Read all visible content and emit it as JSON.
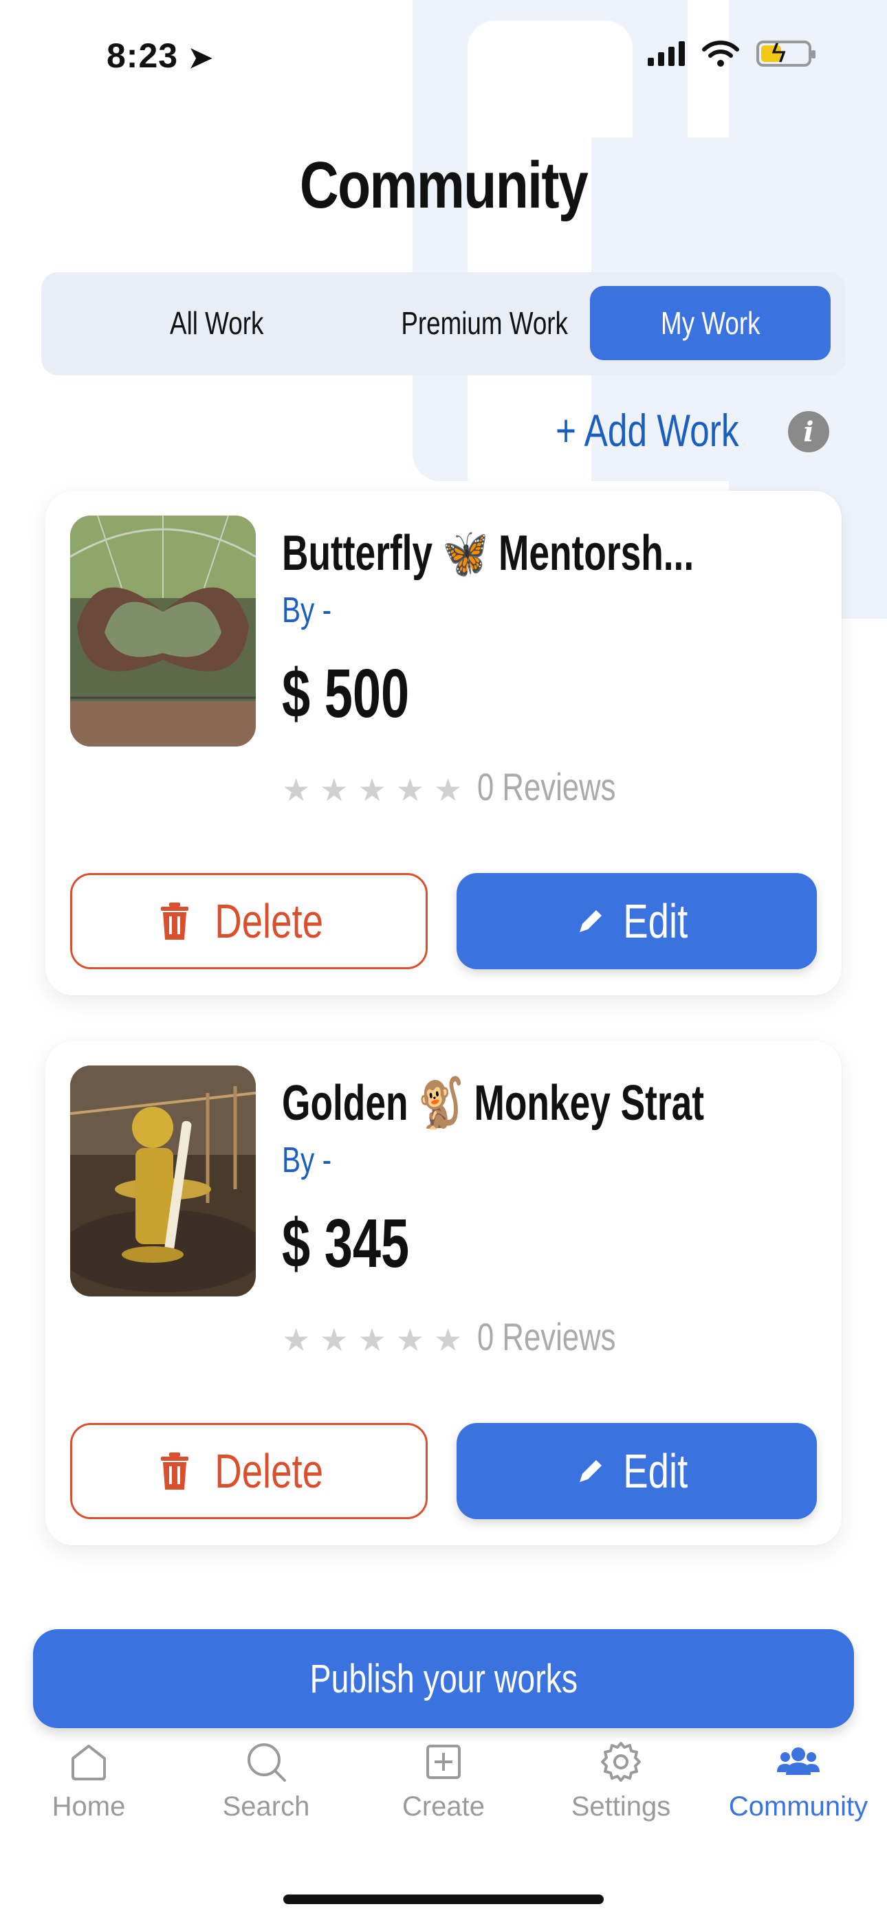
{
  "status": {
    "time": "8:23"
  },
  "page": {
    "title": "Community"
  },
  "tabs": [
    {
      "label": "All Work",
      "active": false
    },
    {
      "label": "Premium Work",
      "active": false
    },
    {
      "label": "My Work",
      "active": true
    }
  ],
  "add_work": {
    "label": "+ Add Work"
  },
  "cards": [
    {
      "title": " Butterfly 🦋 Mentorsh...",
      "by": "By -",
      "price": "$ 500",
      "rating": 0,
      "reviews": "0 Reviews",
      "delete_label": "Delete",
      "edit_label": "Edit"
    },
    {
      "title": "Golden 🐒 Monkey Strat",
      "by": "By -",
      "price": "$ 345",
      "rating": 0,
      "reviews": "0 Reviews",
      "delete_label": "Delete",
      "edit_label": "Edit"
    }
  ],
  "publish": {
    "label": "Publish your works"
  },
  "nav": [
    {
      "label": "Home",
      "icon": "home-icon",
      "active": false
    },
    {
      "label": "Search",
      "icon": "search-icon",
      "active": false
    },
    {
      "label": "Create",
      "icon": "plus-square-icon",
      "active": false
    },
    {
      "label": "Settings",
      "icon": "gear-icon",
      "active": false
    },
    {
      "label": "Community",
      "icon": "users-icon",
      "active": true
    }
  ],
  "colors": {
    "accent": "#3a72e0",
    "danger": "#d9502e",
    "link": "#1a5fc0"
  }
}
